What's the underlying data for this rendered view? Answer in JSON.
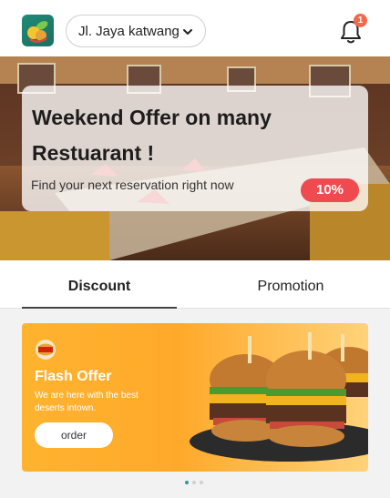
{
  "header": {
    "location": "Jl. Jaya katwang",
    "notification_count": "1"
  },
  "hero": {
    "title": "Weekend Offer on many Restuarant !",
    "subtitle": "Find your next reservation right now",
    "badge": "10%"
  },
  "tabs": [
    {
      "label": "Discount",
      "active": true
    },
    {
      "label": "Promotion",
      "active": false
    }
  ],
  "promo": {
    "brand_logo": "BURGER KING",
    "title": "Flash Offer",
    "text": "We are here with the best deserts intown.",
    "button": "order"
  },
  "carousel": {
    "count": 3,
    "active_index": 0
  },
  "colors": {
    "accent_teal": "#2a9d8f",
    "badge_red": "#ef4a4f",
    "promo_orange": "#ffb32f"
  },
  "icons": [
    "app-logo",
    "chevron-down-icon",
    "bell-icon",
    "burger-king-logo"
  ]
}
